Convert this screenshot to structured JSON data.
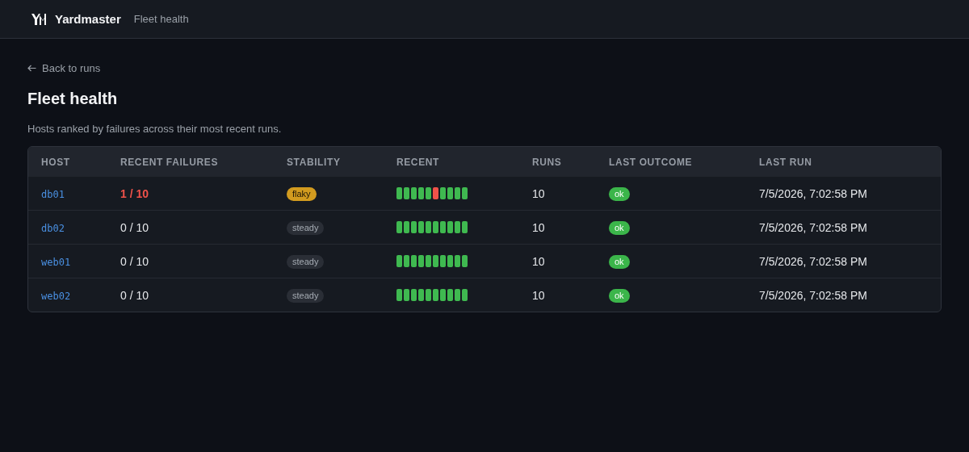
{
  "app": {
    "name": "Yardmaster",
    "section": "Fleet health"
  },
  "back_link": "Back to runs",
  "title": "Fleet health",
  "subtitle": "Hosts ranked by failures across their most recent runs.",
  "table": {
    "columns": [
      "HOST",
      "RECENT FAILURES",
      "STABILITY",
      "RECENT",
      "RUNS",
      "LAST OUTCOME",
      "LAST RUN"
    ],
    "rows": [
      {
        "host": "db01",
        "failures": "1 / 10",
        "alert": true,
        "stability": {
          "label": "flaky",
          "kind": "flaky"
        },
        "recent": [
          {
            "kind": "ok"
          },
          {
            "kind": "ok"
          },
          {
            "kind": "ok"
          },
          {
            "kind": "ok"
          },
          {
            "kind": "ok"
          },
          {
            "kind": "fail"
          },
          {
            "kind": "ok"
          },
          {
            "kind": "ok"
          },
          {
            "kind": "ok"
          },
          {
            "kind": "ok"
          }
        ],
        "runs": "10",
        "outcome": {
          "label": "ok",
          "kind": "ok"
        },
        "last_run": "7/5/2026, 7:02:58 PM"
      },
      {
        "host": "db02",
        "failures": "0 / 10",
        "alert": false,
        "stability": {
          "label": "steady",
          "kind": "steady"
        },
        "recent": [
          {
            "kind": "ok"
          },
          {
            "kind": "ok"
          },
          {
            "kind": "ok"
          },
          {
            "kind": "ok"
          },
          {
            "kind": "ok"
          },
          {
            "kind": "ok"
          },
          {
            "kind": "ok"
          },
          {
            "kind": "ok"
          },
          {
            "kind": "ok"
          },
          {
            "kind": "ok"
          }
        ],
        "runs": "10",
        "outcome": {
          "label": "ok",
          "kind": "ok"
        },
        "last_run": "7/5/2026, 7:02:58 PM"
      },
      {
        "host": "web01",
        "failures": "0 / 10",
        "alert": false,
        "stability": {
          "label": "steady",
          "kind": "steady"
        },
        "recent": [
          {
            "kind": "ok"
          },
          {
            "kind": "ok"
          },
          {
            "kind": "ok"
          },
          {
            "kind": "ok"
          },
          {
            "kind": "ok"
          },
          {
            "kind": "ok"
          },
          {
            "kind": "ok"
          },
          {
            "kind": "ok"
          },
          {
            "kind": "ok"
          },
          {
            "kind": "ok"
          }
        ],
        "runs": "10",
        "outcome": {
          "label": "ok",
          "kind": "ok"
        },
        "last_run": "7/5/2026, 7:02:58 PM"
      },
      {
        "host": "web02",
        "failures": "0 / 10",
        "alert": false,
        "stability": {
          "label": "steady",
          "kind": "steady"
        },
        "recent": [
          {
            "kind": "ok"
          },
          {
            "kind": "ok"
          },
          {
            "kind": "ok"
          },
          {
            "kind": "ok"
          },
          {
            "kind": "ok"
          },
          {
            "kind": "ok"
          },
          {
            "kind": "ok"
          },
          {
            "kind": "ok"
          },
          {
            "kind": "ok"
          },
          {
            "kind": "ok"
          }
        ],
        "runs": "10",
        "outcome": {
          "label": "ok",
          "kind": "ok"
        },
        "last_run": "7/5/2026, 7:02:58 PM"
      }
    ]
  }
}
